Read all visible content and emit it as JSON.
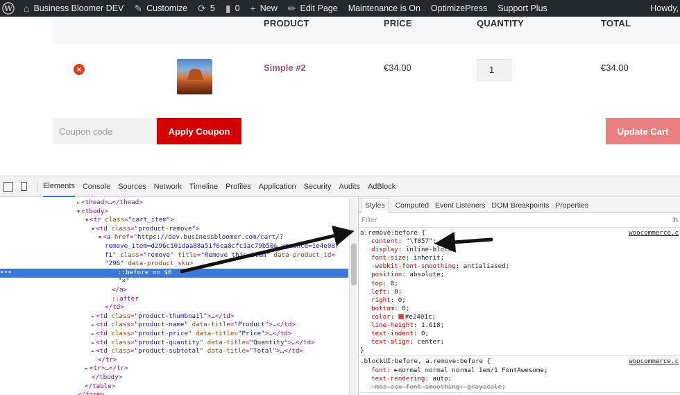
{
  "adminbar": {
    "site_name": "Business Bloomer DEV",
    "customize": "Customize",
    "updates_count": "5",
    "comments_count": "0",
    "new": "New",
    "edit_page": "Edit Page",
    "maintenance": "Maintenance is On",
    "optimizepress": "OptimizePress",
    "support": "Support Plus",
    "howdy": "Howdy,"
  },
  "cart": {
    "headers": {
      "product": "PRODUCT",
      "price": "PRICE",
      "quantity": "QUANTITY",
      "total": "TOTAL"
    },
    "item": {
      "remove": "×",
      "name": "Simple #2",
      "price": "€34.00",
      "quantity": "1",
      "total": "€34.00"
    },
    "coupon_placeholder": "Coupon code",
    "apply_coupon": "Apply Coupon",
    "update_cart": "Update Cart"
  },
  "devtools": {
    "tabs": [
      "Elements",
      "Console",
      "Sources",
      "Network",
      "Timeline",
      "Profiles",
      "Application",
      "Security",
      "Audits",
      "AdBlock"
    ],
    "active_tab": "Elements",
    "dom_lines": [
      {
        "indent": 120,
        "arrow": "►",
        "parts": [
          [
            "tag",
            "<thead>"
          ],
          [
            "txt",
            "…"
          ],
          [
            "tag",
            "</thead>"
          ]
        ]
      },
      {
        "indent": 120,
        "arrow": "▼",
        "parts": [
          [
            "tag",
            "<tbody>"
          ]
        ]
      },
      {
        "indent": 132,
        "arrow": "▼",
        "parts": [
          [
            "tag",
            "<tr "
          ],
          [
            "attr",
            "class"
          ],
          [
            "tag",
            "="
          ],
          [
            "val",
            "\"cart_item\""
          ],
          [
            "tag",
            ">"
          ]
        ]
      },
      {
        "indent": 141,
        "arrow": "▼",
        "parts": [
          [
            "tag",
            "<td "
          ],
          [
            "attr",
            "class"
          ],
          [
            "tag",
            "="
          ],
          [
            "val",
            "\"product-remove\""
          ],
          [
            "tag",
            ">"
          ]
        ]
      },
      {
        "indent": 151,
        "arrow": "▼",
        "parts": [
          [
            "tag",
            "<a "
          ],
          [
            "attr",
            "href"
          ],
          [
            "tag",
            "="
          ],
          [
            "val",
            "\"https://dev.businessbloomer.com/cart/?"
          ]
        ]
      },
      {
        "indent": 151,
        "arrow": "",
        "parts": [
          [
            "val",
            "remove_item=d296c101daa88a51f6ca8cfc1ac79b50&_wpnonce=1e4e087"
          ]
        ]
      },
      {
        "indent": 151,
        "arrow": "",
        "parts": [
          [
            "val",
            "f1\" "
          ],
          [
            "attr",
            "class"
          ],
          [
            "tag",
            "="
          ],
          [
            "val",
            "\"remove\" "
          ],
          [
            "attr",
            "title"
          ],
          [
            "tag",
            "="
          ],
          [
            "val",
            "\"Remove this item\" "
          ],
          [
            "attr",
            "data-product_id"
          ],
          [
            "tag",
            "="
          ]
        ]
      },
      {
        "indent": 151,
        "arrow": "",
        "parts": [
          [
            "val",
            "\"296\" "
          ],
          [
            "attr",
            "data-product_sku"
          ],
          [
            "tag",
            ">"
          ]
        ]
      },
      {
        "indent": 170,
        "arrow": "",
        "parts": [
          [
            "tag",
            "::before"
          ],
          [
            "txt",
            " == $0"
          ]
        ],
        "selected": true
      },
      {
        "indent": 170,
        "arrow": "",
        "parts": [
          [
            "txt",
            "\"×\""
          ]
        ]
      },
      {
        "indent": 161,
        "arrow": "",
        "parts": [
          [
            "tag",
            "</a>"
          ]
        ]
      },
      {
        "indent": 161,
        "arrow": "",
        "parts": [
          [
            "tag",
            "::after"
          ]
        ]
      },
      {
        "indent": 151,
        "arrow": "",
        "parts": [
          [
            "tag",
            "</td>"
          ]
        ]
      },
      {
        "indent": 141,
        "arrow": "►",
        "parts": [
          [
            "tag",
            "<td "
          ],
          [
            "attr",
            "class"
          ],
          [
            "tag",
            "="
          ],
          [
            "val",
            "\"product-thumbnail\""
          ],
          [
            "tag",
            ">"
          ],
          [
            "txt",
            "…"
          ],
          [
            "tag",
            "</td>"
          ]
        ]
      },
      {
        "indent": 141,
        "arrow": "►",
        "parts": [
          [
            "tag",
            "<td "
          ],
          [
            "attr",
            "class"
          ],
          [
            "tag",
            "="
          ],
          [
            "val",
            "\"product-name\" "
          ],
          [
            "attr",
            "data-title"
          ],
          [
            "tag",
            "="
          ],
          [
            "val",
            "\"Product\""
          ],
          [
            "tag",
            ">"
          ],
          [
            "txt",
            "…"
          ],
          [
            "tag",
            "</td>"
          ]
        ]
      },
      {
        "indent": 141,
        "arrow": "►",
        "parts": [
          [
            "tag",
            "<td "
          ],
          [
            "attr",
            "class"
          ],
          [
            "tag",
            "="
          ],
          [
            "val",
            "\"product-price\" "
          ],
          [
            "attr",
            "data-title"
          ],
          [
            "tag",
            "="
          ],
          [
            "val",
            "\"Price\""
          ],
          [
            "tag",
            ">"
          ],
          [
            "txt",
            "…"
          ],
          [
            "tag",
            "</td>"
          ]
        ]
      },
      {
        "indent": 141,
        "arrow": "►",
        "parts": [
          [
            "tag",
            "<td "
          ],
          [
            "attr",
            "class"
          ],
          [
            "tag",
            "="
          ],
          [
            "val",
            "\"product-quantity\" "
          ],
          [
            "attr",
            "data-title"
          ],
          [
            "tag",
            "="
          ],
          [
            "val",
            "\"Quantity\""
          ],
          [
            "tag",
            ">"
          ],
          [
            "txt",
            "…"
          ],
          [
            "tag",
            "</td>"
          ]
        ]
      },
      {
        "indent": 141,
        "arrow": "►",
        "parts": [
          [
            "tag",
            "<td "
          ],
          [
            "attr",
            "class"
          ],
          [
            "tag",
            "="
          ],
          [
            "val",
            "\"product-subtotal\" "
          ],
          [
            "attr",
            "data-title"
          ],
          [
            "tag",
            "="
          ],
          [
            "val",
            "\"Total\""
          ],
          [
            "tag",
            ">"
          ],
          [
            "txt",
            "…"
          ],
          [
            "tag",
            "</td>"
          ]
        ]
      },
      {
        "indent": 141,
        "arrow": "",
        "parts": [
          [
            "tag",
            "</tr>"
          ]
        ]
      },
      {
        "indent": 132,
        "arrow": "►",
        "parts": [
          [
            "tag",
            "<tr>"
          ],
          [
            "txt",
            "…"
          ],
          [
            "tag",
            "</tr>"
          ]
        ]
      },
      {
        "indent": 132,
        "arrow": "",
        "parts": [
          [
            "tag",
            "</tbody>"
          ]
        ]
      },
      {
        "indent": 122,
        "arrow": "",
        "parts": [
          [
            "tag",
            "</table>"
          ]
        ]
      },
      {
        "indent": 112,
        "arrow": "",
        "parts": [
          [
            "tag",
            "</form>"
          ]
        ]
      }
    ],
    "styles_tabs": [
      "Styles",
      "Computed",
      "Event Listeners",
      "DOM Breakpoints",
      "Properties"
    ],
    "filter_placeholder": "Filter",
    "filter_right": ":h",
    "rules": [
      {
        "selector": "a.remove:before {",
        "source": "woocommerce.c",
        "decls": [
          {
            "p": "content",
            "v": " \"\\f057\";"
          },
          {
            "p": "display",
            "v": " inline-block;"
          },
          {
            "p": "font-size",
            "v": " inherit;"
          },
          {
            "p": "-webkit-font-smoothing",
            "v": " antialiased;"
          },
          {
            "p": "position",
            "v": " absolute;"
          },
          {
            "p": "top",
            "v": " 0;"
          },
          {
            "p": "left",
            "v": " 0;"
          },
          {
            "p": "right",
            "v": " 0;"
          },
          {
            "p": "bottom",
            "v": " 0;"
          },
          {
            "p": "color",
            "v": "#e2401c;",
            "swatch": true
          },
          {
            "p": "line-height",
            "v": " 1.618;"
          },
          {
            "p": "text-indent",
            "v": " 0;"
          },
          {
            "p": "text-align",
            "v": " center;"
          }
        ],
        "close": "}"
      },
      {
        "selector": ".blockUI:before, a.remove:before {",
        "source": "woocommerce.c",
        "decls": [
          {
            "p": "font",
            "v": "►normal normal normal 1em/1 FontAwesome;"
          },
          {
            "p": "text-rendering",
            "v": " auto;"
          },
          {
            "p": "-moz-osx-font-smoothing",
            "v": " grayscale;",
            "strike": true
          }
        ],
        "close": ""
      }
    ]
  },
  "colors": {
    "accent_red": "#d40000",
    "remove_red": "#e2401c",
    "product_purple": "#96588a",
    "update_btn": "#e88080",
    "devtools_select": "#3879d9"
  }
}
